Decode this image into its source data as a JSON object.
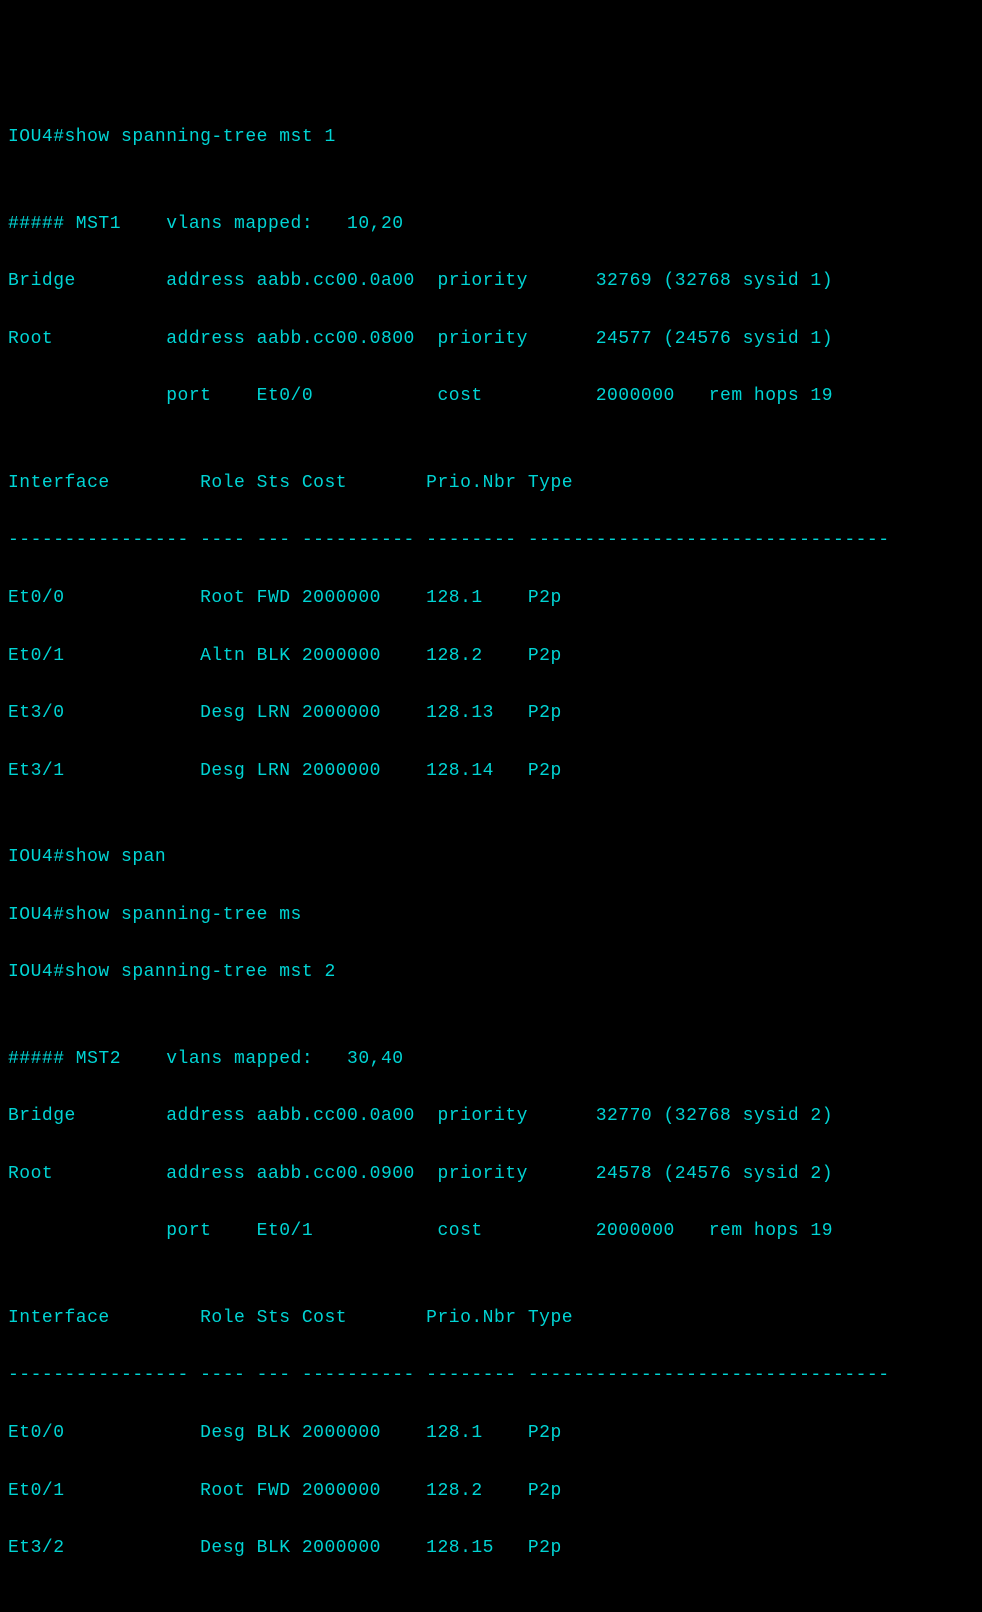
{
  "colors": {
    "bg": "#000000",
    "fg": "#00d4d4"
  },
  "cmd1": "IOU4#show spanning-tree mst 1",
  "blank": "",
  "mst1": {
    "header": "##### MST1    vlans mapped:   10,20",
    "bridge": "Bridge        address aabb.cc00.0a00  priority      32769 (32768 sysid 1)",
    "root": "Root          address aabb.cc00.0800  priority      24577 (24576 sysid 1)",
    "rootln2": "              port    Et0/0           cost          2000000   rem hops 19",
    "tblhdr": "Interface        Role Sts Cost       Prio.Nbr Type",
    "tblsep": "---------------- ---- --- ---------- -------- --------------------------------",
    "r0": "Et0/0            Root FWD 2000000    128.1    P2p ",
    "r1": "Et0/1            Altn BLK 2000000    128.2    P2p ",
    "r2": "Et3/0            Desg LRN 2000000    128.13   P2p ",
    "r3": "Et3/1            Desg LRN 2000000    128.14   P2p "
  },
  "cmd2": "IOU4#show span",
  "cmd3": "IOU4#show spanning-tree ms",
  "cmd4": "IOU4#show spanning-tree mst 2",
  "mst2": {
    "header": "##### MST2    vlans mapped:   30,40",
    "bridge": "Bridge        address aabb.cc00.0a00  priority      32770 (32768 sysid 2)",
    "root": "Root          address aabb.cc00.0900  priority      24578 (24576 sysid 2)",
    "rootln2": "              port    Et0/1           cost          2000000   rem hops 19",
    "tblhdr": "Interface        Role Sts Cost       Prio.Nbr Type",
    "tblsep": "---------------- ---- --- ---------- -------- --------------------------------",
    "r0": "Et0/0            Desg BLK 2000000    128.1    P2p ",
    "r1": "Et0/1            Root FWD 2000000    128.2    P2p ",
    "r2": "Et3/2            Desg BLK 2000000    128.15   P2p "
  }
}
